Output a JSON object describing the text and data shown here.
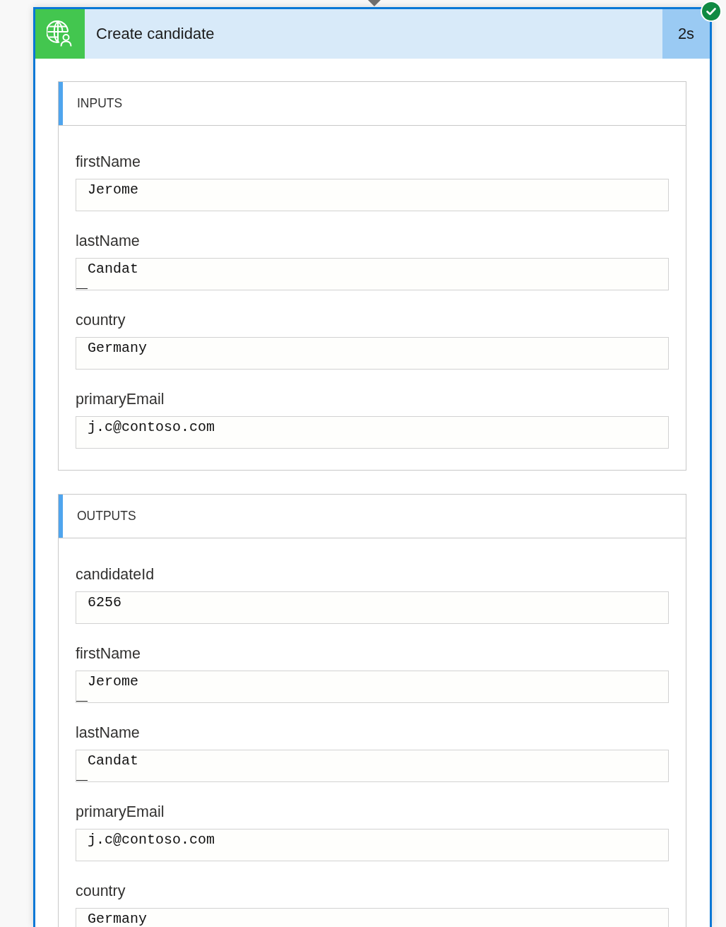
{
  "action": {
    "title": "Create candidate",
    "duration": "2s",
    "succeeded": true
  },
  "sections": [
    {
      "title": "INPUTS",
      "fields": [
        {
          "label": "firstName",
          "value": "Jerome",
          "cursor_mark": false
        },
        {
          "label": "lastName",
          "value": "Candat",
          "cursor_mark": true
        },
        {
          "label": "country",
          "value": "Germany",
          "cursor_mark": false
        },
        {
          "label": "primaryEmail",
          "value": "j.c@contoso.com",
          "cursor_mark": false
        }
      ]
    },
    {
      "title": "OUTPUTS",
      "fields": [
        {
          "label": "candidateId",
          "value": "6256",
          "cursor_mark": false
        },
        {
          "label": "firstName",
          "value": "Jerome",
          "cursor_mark": true
        },
        {
          "label": "lastName",
          "value": "Candat",
          "cursor_mark": true
        },
        {
          "label": "primaryEmail",
          "value": "j.c@contoso.com",
          "cursor_mark": false
        },
        {
          "label": "country",
          "value": "Germany",
          "cursor_mark": false
        }
      ]
    }
  ]
}
